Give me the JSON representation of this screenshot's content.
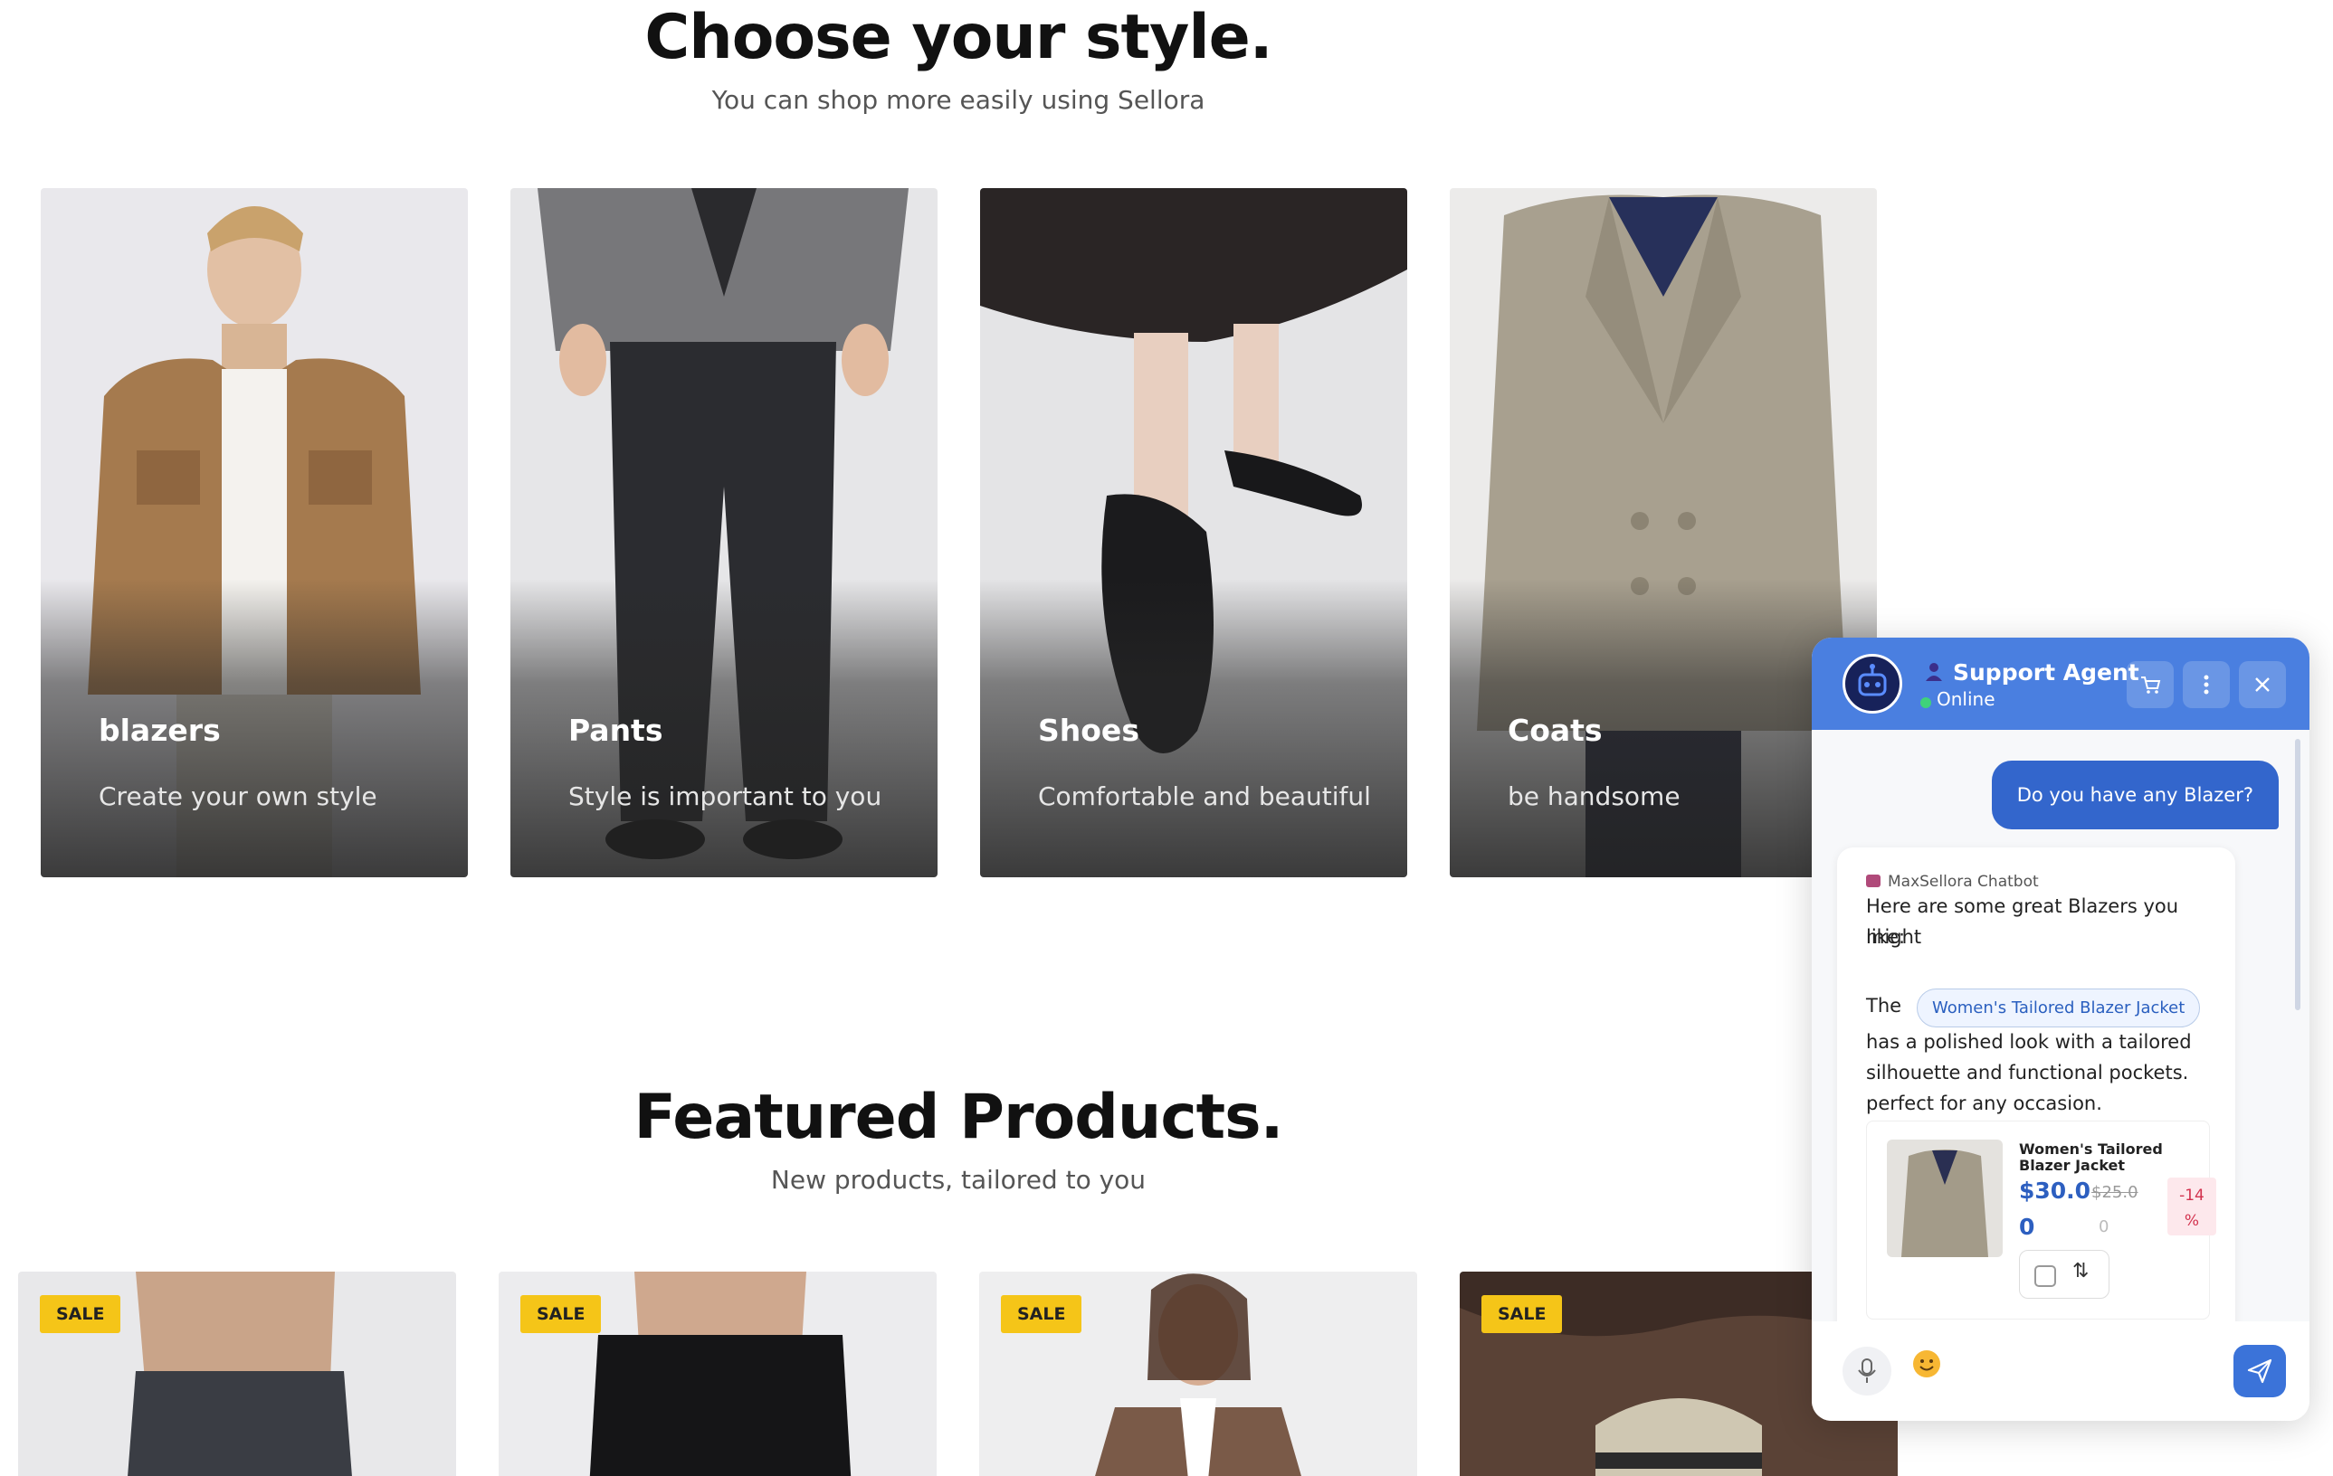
{
  "styles_section": {
    "title": "Choose your style.",
    "subtitle": "You can shop more easily using Sellora",
    "categories": [
      {
        "name": "blazers",
        "description": "Create your own style"
      },
      {
        "name": "Pants",
        "description": "Style is important to you"
      },
      {
        "name": "Shoes",
        "description": "Comfortable and beautiful"
      },
      {
        "name": "Coats",
        "description": "be handsome"
      }
    ]
  },
  "featured_section": {
    "title": "Featured Products.",
    "subtitle": "New products, tailored to you",
    "products": [
      {
        "badge": "SALE"
      },
      {
        "badge": "SALE"
      },
      {
        "badge": "SALE"
      },
      {
        "badge": "SALE"
      }
    ]
  },
  "chat": {
    "agent_name": "Support Agent",
    "status": "Online",
    "user_message": "Do you have any Blazer?",
    "bot_label": "MaxSellora Chatbot",
    "bot_intro_line1": "Here are some great Blazers you might",
    "bot_intro_line2": "like:",
    "bot_the": "The",
    "product_chip": "Women's Tailored Blazer Jacket",
    "bot_desc_line1": "has a polished look with a tailored",
    "bot_desc_line2": "silhouette and functional pockets.",
    "bot_desc_line3": "perfect for any occasion.",
    "product_card": {
      "name_line1": "Women's Tailored",
      "name_line2": "Blazer Jacket",
      "price": "$30.0",
      "price_cont": "0",
      "old_price": "$25.0",
      "old_price_cont": "0",
      "discount_line1": "-14",
      "discount_line2": "%"
    },
    "icons": {
      "cart": "cart-icon",
      "menu": "more-vertical-icon",
      "close": "close-icon",
      "mic": "microphone-icon",
      "emoji": "emoji-icon",
      "send": "send-icon"
    },
    "accent_color": "#4a7fe0"
  }
}
